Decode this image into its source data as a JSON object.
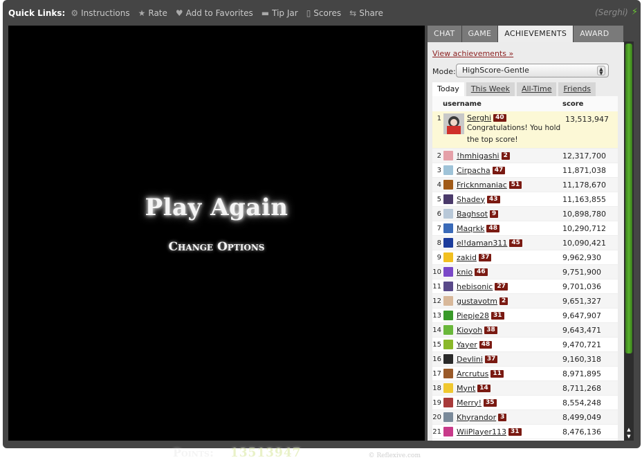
{
  "toolbar": {
    "title": "Quick Links:",
    "links": [
      {
        "label": "Instructions",
        "icon": "gear-icon"
      },
      {
        "label": "Rate",
        "icon": "star-icon"
      },
      {
        "label": "Add to Favorites",
        "icon": "heart-icon"
      },
      {
        "label": "Tip Jar",
        "icon": "jar-icon"
      },
      {
        "label": "Scores",
        "icon": "scores-icon"
      },
      {
        "label": "Share",
        "icon": "share-icon"
      }
    ],
    "user": "(Serghi)"
  },
  "game": {
    "play_again": "Play Again",
    "change_options": "Change Options",
    "points_label": "Points:",
    "points_value": "13513947",
    "copyright": "© Reflexive.com"
  },
  "side": {
    "tabs": [
      "CHAT",
      "GAME",
      "ACHIEVEMENTS",
      "AWARD"
    ],
    "active_tab": "ACHIEVEMENTS",
    "view_achievements": "View achievements »",
    "mode_label": "Mode:",
    "mode_value": "HighScore-Gentle",
    "score_tabs": [
      "Today",
      "This Week",
      "All-Time",
      "Friends"
    ],
    "columns": {
      "username": "username",
      "score": "score"
    },
    "top": {
      "rank": "1",
      "user": "Serghi",
      "level": "40",
      "score": "13,513,947",
      "message_line1": "Congratulations! You hold",
      "message_line2": "the top score!"
    },
    "rows": [
      {
        "rank": "2",
        "user": "!hmhigashi",
        "level": "2",
        "score": "12,317,700",
        "color": "#e5a0a8"
      },
      {
        "rank": "3",
        "user": "Cirpacha",
        "level": "47",
        "score": "11,871,038",
        "color": "#9fc3d8"
      },
      {
        "rank": "4",
        "user": "Fricknmaniac",
        "level": "51",
        "score": "11,178,670",
        "color": "#a05a18"
      },
      {
        "rank": "5",
        "user": "Shadey",
        "level": "43",
        "score": "11,163,855",
        "color": "#4a3a6a"
      },
      {
        "rank": "6",
        "user": "Baghsot",
        "level": "9",
        "score": "10,898,780",
        "color": "#b8c8d8"
      },
      {
        "rank": "7",
        "user": "Maqrkk",
        "level": "48",
        "score": "10,290,712",
        "color": "#3a6ab8"
      },
      {
        "rank": "8",
        "user": "el!daman311",
        "level": "45",
        "score": "10,090,421",
        "color": "#1c3c9c"
      },
      {
        "rank": "9",
        "user": "zakid",
        "level": "37",
        "score": "9,962,930",
        "color": "#f2c020"
      },
      {
        "rank": "10",
        "user": "knio",
        "level": "46",
        "score": "9,751,900",
        "color": "#7a48c8"
      },
      {
        "rank": "11",
        "user": "hebisonic",
        "level": "27",
        "score": "9,701,036",
        "color": "#5a4a8a"
      },
      {
        "rank": "12",
        "user": "gustavotm",
        "level": "2",
        "score": "9,651,327",
        "color": "#d8b89a"
      },
      {
        "rank": "13",
        "user": "Piepje28",
        "level": "31",
        "score": "9,647,907",
        "color": "#3a9a2a"
      },
      {
        "rank": "14",
        "user": "Kioyoh",
        "level": "38",
        "score": "9,643,471",
        "color": "#6ab83a"
      },
      {
        "rank": "15",
        "user": "Yayer",
        "level": "48",
        "score": "9,470,721",
        "color": "#8ab82a"
      },
      {
        "rank": "16",
        "user": "Devlini",
        "level": "37",
        "score": "9,160,318",
        "color": "#2a2a2a"
      },
      {
        "rank": "17",
        "user": "Arcrutus",
        "level": "11",
        "score": "8,971,895",
        "color": "#9a5a2a"
      },
      {
        "rank": "18",
        "user": "Mynt",
        "level": "14",
        "score": "8,711,268",
        "color": "#f0c830"
      },
      {
        "rank": "19",
        "user": "Merry!",
        "level": "35",
        "score": "8,554,248",
        "color": "#a83a3a"
      },
      {
        "rank": "20",
        "user": "Khyrandor",
        "level": "3",
        "score": "8,499,049",
        "color": "#7a8a9a"
      },
      {
        "rank": "21",
        "user": "WiiPlayer113",
        "level": "31",
        "score": "8,476,136",
        "color": "#c83a8a"
      }
    ]
  },
  "colors": {
    "frame": "#454545",
    "level_badge": "#7a1a12",
    "link": "#8b1f1f",
    "scroll_thumb": "#58b22c"
  }
}
